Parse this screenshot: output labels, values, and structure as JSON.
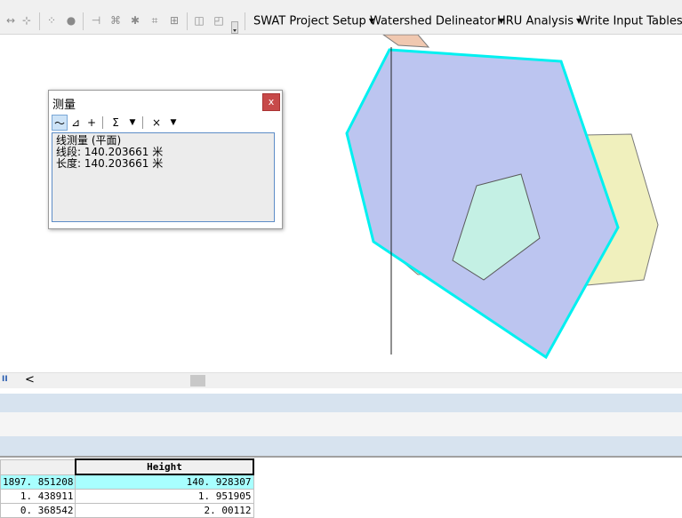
{
  "toolbar": {
    "swat_menus": [
      "SWAT Project Setup",
      "Watershed Delineator",
      "HRU Analysis",
      "Write Input Tables"
    ]
  },
  "measure_dialog": {
    "title": "测量",
    "close_label": "x",
    "tools": {
      "line": "〜",
      "area": "⊿",
      "feature": "+",
      "sum": "Σ",
      "clear": "×"
    },
    "mode_text": "线测量 (平面)",
    "segment_text": "线段: 140.203661 米",
    "length_text": "长度: 140.203661 米"
  },
  "scroll": {
    "left_arrow": "<",
    "pause": "II"
  },
  "table": {
    "header": "Height",
    "rows": [
      {
        "a": "1897. 851208",
        "b": "140. 928307",
        "selected": true
      },
      {
        "a": "1. 438911",
        "b": "1. 951905",
        "selected": false
      },
      {
        "a": "0. 368542",
        "b": "2. 00112",
        "selected": false
      }
    ]
  },
  "colors": {
    "selection_outline": "#00f0f0",
    "selected_polygon_fill": "#bcc5f0",
    "background_polygon_fill": "#f0f0bd",
    "inner_polygon_fill": "#c4f0e4",
    "orange_polygon_fill": "#f0c8b0",
    "table_selected_row": "#a8ffff"
  }
}
